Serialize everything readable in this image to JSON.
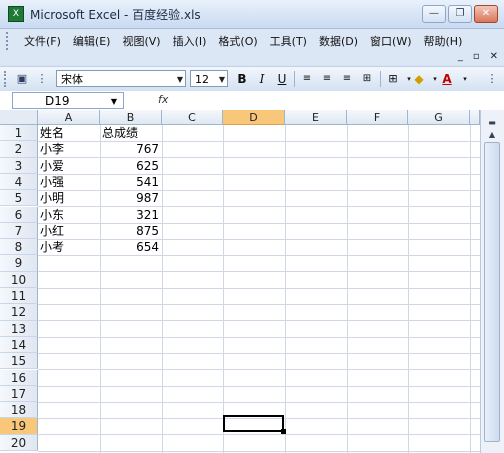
{
  "window": {
    "title": "Microsoft Excel - 百度经验.xls"
  },
  "menu": {
    "items": [
      "文件(F)",
      "编辑(E)",
      "视图(V)",
      "插入(I)",
      "格式(O)",
      "工具(T)",
      "数据(D)",
      "窗口(W)",
      "帮助(H)"
    ]
  },
  "toolbar": {
    "font_name": "宋体",
    "font_size": "12",
    "bold": "B",
    "italic": "I",
    "underline": "U",
    "font_color_label": "A"
  },
  "formula_bar": {
    "name_box": "D19",
    "fx": "fx",
    "formula": ""
  },
  "grid": {
    "columns": [
      "A",
      "B",
      "C",
      "D",
      "E",
      "F",
      "G"
    ],
    "active_column": "D",
    "rows": [
      "1",
      "2",
      "3",
      "4",
      "5",
      "6",
      "7",
      "8",
      "9",
      "10",
      "11",
      "12",
      "13",
      "14",
      "15",
      "16",
      "17",
      "18",
      "19",
      "20"
    ],
    "active_row": "19",
    "header": {
      "A": "姓名",
      "B": "总成绩"
    },
    "records": [
      {
        "name": "小李",
        "score": "767"
      },
      {
        "name": "小爱",
        "score": "625"
      },
      {
        "name": "小强",
        "score": "541"
      },
      {
        "name": "小明",
        "score": "987"
      },
      {
        "name": "小东",
        "score": "321"
      },
      {
        "name": "小红",
        "score": "875"
      },
      {
        "name": "小考",
        "score": "654"
      }
    ]
  }
}
